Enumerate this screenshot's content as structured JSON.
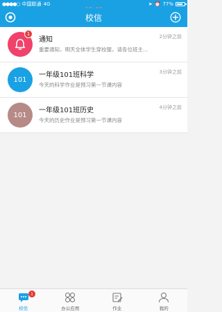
{
  "status_bar": {
    "carrier": "中国联通",
    "network": "4G",
    "time": "15:43",
    "battery": "77%"
  },
  "header": {
    "title": "校信"
  },
  "conversations": [
    {
      "name": "通知",
      "time": "2分钟之前",
      "preview": "重要通知，明天全体学生穿校服，请各位班主...",
      "avatar_icon": "bell-icon",
      "avatar_color": "#f0426a",
      "badge": "1"
    },
    {
      "name": "一年级101班科学",
      "time": "3分钟之前",
      "preview": "今天的科学作业是预习第一节课内容",
      "avatar_text": "101",
      "avatar_color": "#1aa1e4"
    },
    {
      "name": "一年级101班历史",
      "time": "4分钟之前",
      "preview": "今天的历史作业是预习第一节课内容",
      "avatar_text": "101",
      "avatar_color": "#b68a87"
    }
  ],
  "tabs": [
    {
      "label": "校信",
      "icon": "chat-icon",
      "badge": "1",
      "active": true
    },
    {
      "label": "办公应用",
      "icon": "apps-icon"
    },
    {
      "label": "作业",
      "icon": "edit-icon"
    },
    {
      "label": "我的",
      "icon": "user-icon"
    }
  ],
  "colors": {
    "primary": "#1aa1e4",
    "badge": "#e53935"
  }
}
